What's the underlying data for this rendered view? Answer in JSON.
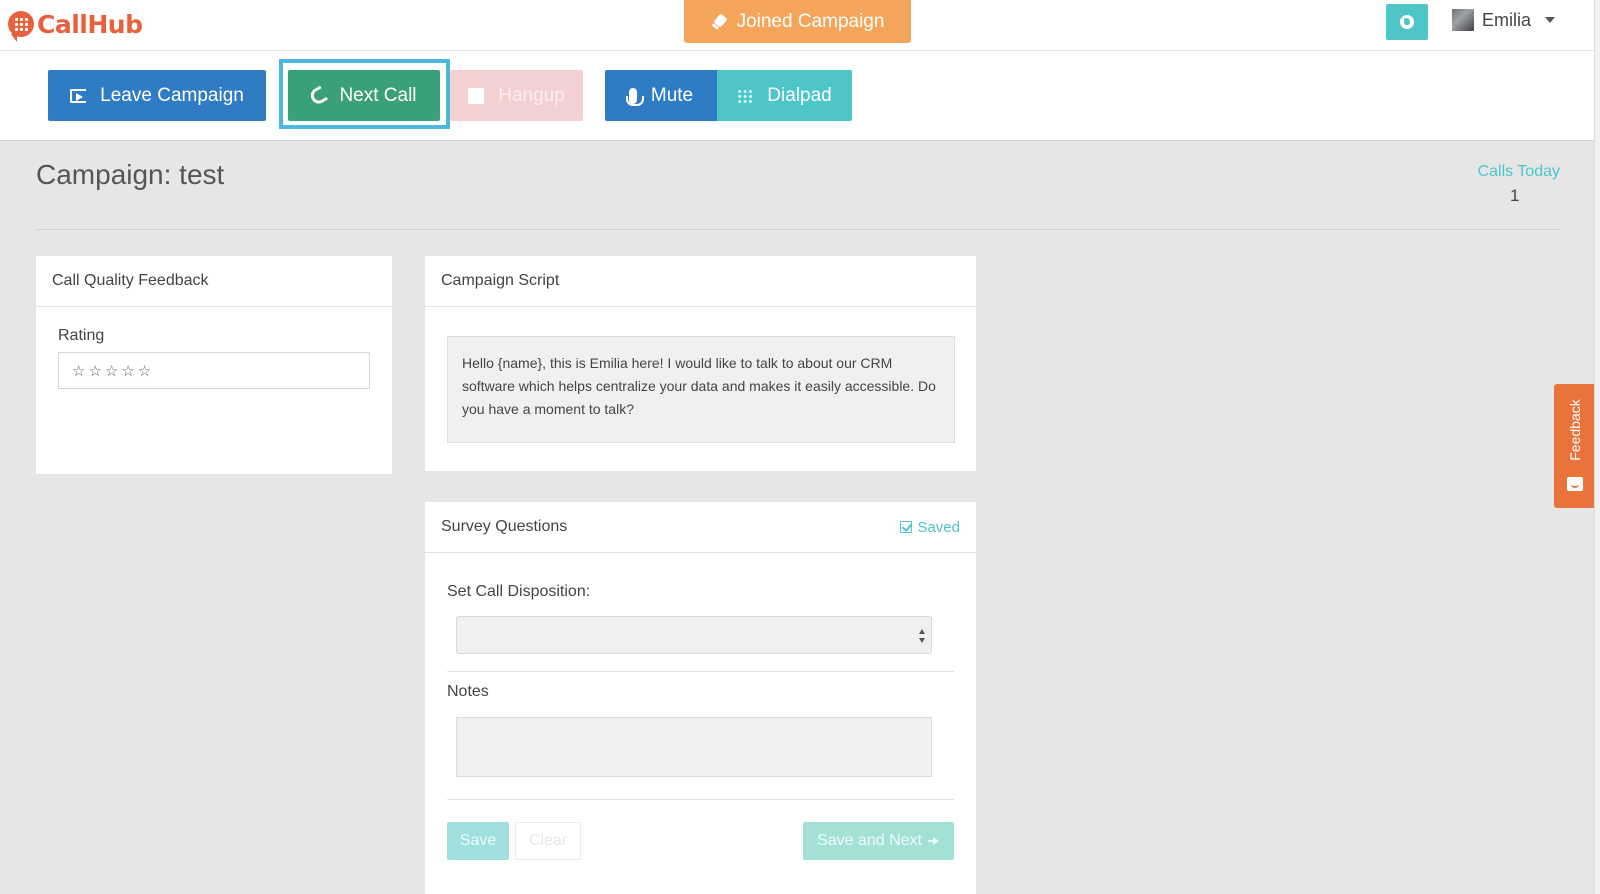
{
  "brand": {
    "logo_text": "CallHub",
    "accent": "#e8613c"
  },
  "topbar": {
    "joined_label": "Joined Campaign",
    "joined_color": "#f4a55a",
    "globe_icon": "globe-icon",
    "user_name": "Emilia"
  },
  "toolbar": {
    "leave_label": "Leave Campaign",
    "next_call_label": "Next Call",
    "hangup_label": "Hangup",
    "mute_label": "Mute",
    "dialpad_label": "Dialpad"
  },
  "header": {
    "title": "Campaign: test",
    "calls_today_label": "Calls Today",
    "calls_today_value": "1"
  },
  "call_quality": {
    "title": "Call Quality Feedback",
    "rating_label": "Rating",
    "rating_value": 0,
    "rating_max": 5,
    "stars": [
      "☆",
      "☆",
      "☆",
      "☆",
      "☆"
    ]
  },
  "script": {
    "title": "Campaign Script",
    "text": "Hello {name}, this is Emilia here! I would like to talk to about our CRM software which helps centralize your data and makes it easily accessible. Do you have a moment to talk?"
  },
  "survey": {
    "title": "Survey Questions",
    "saved_label": "Saved",
    "disposition_label": "Set Call Disposition:",
    "disposition_value": "",
    "notes_label": "Notes",
    "notes_value": "",
    "save_label": "Save",
    "clear_label": "Clear",
    "save_next_label": "Save and Next"
  },
  "feedback_tab": {
    "label": "Feedback"
  }
}
